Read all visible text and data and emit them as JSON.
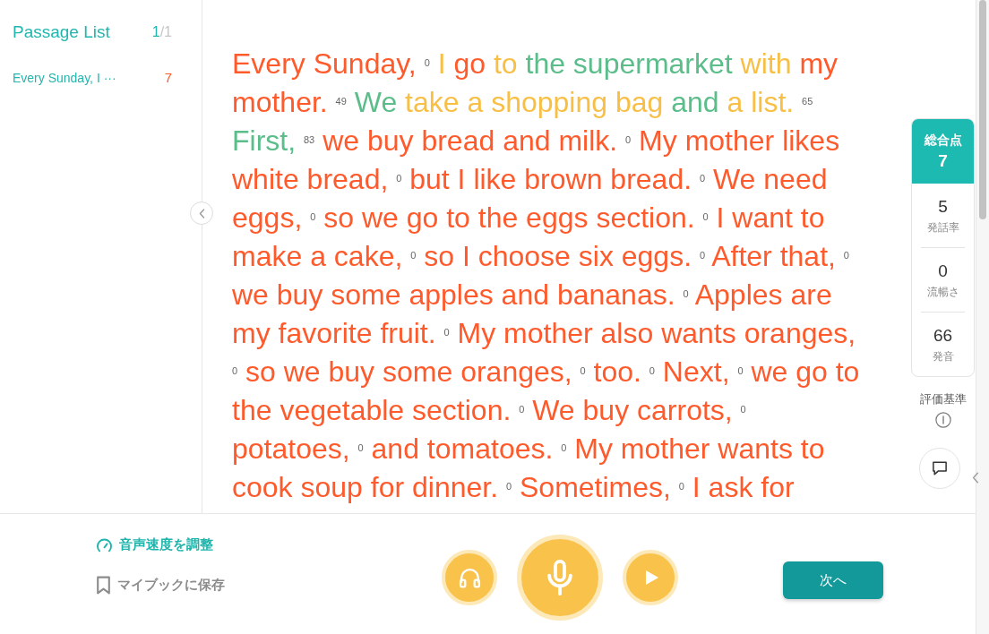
{
  "sidebar": {
    "title": "Passage List",
    "counter": {
      "current": "1",
      "separator": "/",
      "total": "1"
    },
    "items": [
      {
        "title": "Every Sunday, I ···",
        "score": "7",
        "selected": true
      }
    ]
  },
  "passage": {
    "lines": [
      {
        "items": [
          {
            "kind": "words",
            "text": "Every Sunday,",
            "color": "#fe5a2b"
          },
          {
            "kind": "score",
            "text": "0"
          },
          {
            "kind": "words",
            "text": "I",
            "color": "#f8bf46"
          },
          {
            "kind": "words",
            "text": "go",
            "color": "#fe5a2b"
          },
          {
            "kind": "words",
            "text": "to",
            "color": "#f8bf46"
          },
          {
            "kind": "words",
            "text": "the supermarket",
            "color": "#5bbd8a"
          },
          {
            "kind": "words",
            "text": "with",
            "color": "#f8bf46"
          },
          {
            "kind": "words",
            "text": "my",
            "color": "#fe5a2b"
          }
        ]
      },
      {
        "items": [
          {
            "kind": "words",
            "text": "mother.",
            "color": "#fe5a2b"
          },
          {
            "kind": "score",
            "text": "49"
          },
          {
            "kind": "words",
            "text": "We",
            "color": "#5bbd8a"
          },
          {
            "kind": "words",
            "text": "take a shopping bag",
            "color": "#f8bf46"
          },
          {
            "kind": "words",
            "text": "and",
            "color": "#5bbd8a"
          },
          {
            "kind": "words",
            "text": "a list.",
            "color": "#f8bf46"
          },
          {
            "kind": "score",
            "text": "65"
          }
        ]
      },
      {
        "items": [
          {
            "kind": "words",
            "text": "First,",
            "color": "#5bbd8a"
          },
          {
            "kind": "score",
            "text": "83"
          },
          {
            "kind": "words",
            "text": "we buy bread and milk.",
            "color": "#fe5a2b"
          },
          {
            "kind": "score",
            "text": "0"
          },
          {
            "kind": "words",
            "text": "My mother likes",
            "color": "#fe5a2b"
          }
        ]
      },
      {
        "items": [
          {
            "kind": "words",
            "text": "white bread,",
            "color": "#fe5a2b"
          },
          {
            "kind": "score",
            "text": "0"
          },
          {
            "kind": "words",
            "text": "but I like brown bread.",
            "color": "#fe5a2b"
          },
          {
            "kind": "score",
            "text": "0"
          },
          {
            "kind": "words",
            "text": "We need",
            "color": "#fe5a2b"
          }
        ]
      },
      {
        "items": [
          {
            "kind": "words",
            "text": "eggs,",
            "color": "#fe5a2b"
          },
          {
            "kind": "score",
            "text": "0"
          },
          {
            "kind": "words",
            "text": "so we go to the eggs section.",
            "color": "#fe5a2b"
          },
          {
            "kind": "score",
            "text": "0"
          },
          {
            "kind": "words",
            "text": "I want to",
            "color": "#fe5a2b"
          }
        ]
      },
      {
        "items": [
          {
            "kind": "words",
            "text": "make a cake,",
            "color": "#fe5a2b"
          },
          {
            "kind": "score",
            "text": "0"
          },
          {
            "kind": "words",
            "text": "so I choose six eggs.",
            "color": "#fe5a2b"
          },
          {
            "kind": "score",
            "text": "0"
          },
          {
            "kind": "words",
            "text": "After that,",
            "color": "#fe5a2b"
          },
          {
            "kind": "score",
            "text": "0"
          }
        ]
      },
      {
        "items": [
          {
            "kind": "words",
            "text": "we buy some apples and bananas.",
            "color": "#fe5a2b"
          },
          {
            "kind": "score",
            "text": "0"
          },
          {
            "kind": "words",
            "text": "Apples are",
            "color": "#fe5a2b"
          }
        ]
      },
      {
        "items": [
          {
            "kind": "words",
            "text": "my favorite fruit.",
            "color": "#fe5a2b"
          },
          {
            "kind": "score",
            "text": "0"
          },
          {
            "kind": "words",
            "text": "My mother also wants oranges,",
            "color": "#fe5a2b"
          }
        ]
      },
      {
        "items": [
          {
            "kind": "score",
            "text": "0"
          },
          {
            "kind": "words",
            "text": "so we buy some oranges,",
            "color": "#fe5a2b"
          },
          {
            "kind": "score",
            "text": "0"
          },
          {
            "kind": "words",
            "text": "too.",
            "color": "#fe5a2b"
          },
          {
            "kind": "score",
            "text": "0"
          },
          {
            "kind": "words",
            "text": "Next,",
            "color": "#fe5a2b"
          },
          {
            "kind": "score",
            "text": "0"
          },
          {
            "kind": "words",
            "text": "we go to",
            "color": "#fe5a2b"
          }
        ]
      },
      {
        "items": [
          {
            "kind": "words",
            "text": "the vegetable section.",
            "color": "#fe5a2b"
          },
          {
            "kind": "score",
            "text": "0"
          },
          {
            "kind": "words",
            "text": "We buy carrots,",
            "color": "#fe5a2b"
          },
          {
            "kind": "score",
            "text": "0"
          }
        ]
      },
      {
        "items": [
          {
            "kind": "words",
            "text": "potatoes,",
            "color": "#fe5a2b"
          },
          {
            "kind": "score",
            "text": "0"
          },
          {
            "kind": "words",
            "text": "and tomatoes.",
            "color": "#fe5a2b"
          },
          {
            "kind": "score",
            "text": "0"
          },
          {
            "kind": "words",
            "text": "My mother wants to",
            "color": "#fe5a2b"
          }
        ]
      },
      {
        "items": [
          {
            "kind": "words",
            "text": "cook soup for dinner.",
            "color": "#fe5a2b"
          },
          {
            "kind": "score",
            "text": "0"
          },
          {
            "kind": "words",
            "text": "Sometimes,",
            "color": "#fe5a2b"
          },
          {
            "kind": "score",
            "text": "0"
          },
          {
            "kind": "words",
            "text": "I ask for",
            "color": "#fe5a2b"
          }
        ]
      }
    ]
  },
  "score_panel": {
    "total": {
      "label": "総合点",
      "value": "7"
    },
    "metrics": [
      {
        "value": "5",
        "label": "発話率"
      },
      {
        "value": "0",
        "label": "流暢さ"
      },
      {
        "value": "66",
        "label": "発音"
      }
    ],
    "criteria": "評価基準"
  },
  "bottom_bar": {
    "options": [
      {
        "kind": "speed",
        "label": "音声速度を調整"
      },
      {
        "kind": "bookmark",
        "label": "マイブックに保存"
      }
    ],
    "next_button": "次へ"
  }
}
